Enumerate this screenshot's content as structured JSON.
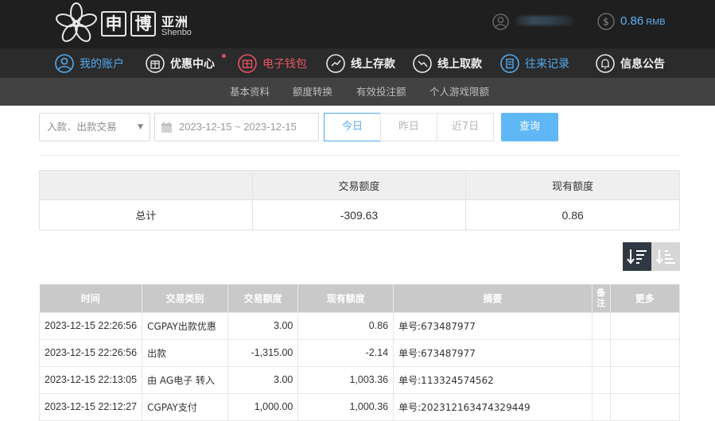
{
  "brand": {
    "name_cn": "申博",
    "region_cn": "亚洲",
    "name_en": "Shenbo"
  },
  "header": {
    "balance_amount": "0.86",
    "balance_currency": "RMB"
  },
  "nav": [
    {
      "label": "我的账户",
      "icon": "user-circle-icon",
      "color": "#52a9ee"
    },
    {
      "label": "优惠中心",
      "icon": "gift-icon"
    },
    {
      "label": "电子钱包",
      "icon": "wallet-icon",
      "color": "#e85563"
    },
    {
      "label": "线上存款",
      "icon": "deposit-icon"
    },
    {
      "label": "线上取款",
      "icon": "withdraw-icon"
    },
    {
      "label": "往来记录",
      "icon": "record-icon",
      "color": "#52a9ee"
    },
    {
      "label": "信息公告",
      "icon": "bell-icon"
    }
  ],
  "subnav": [
    "基本资料",
    "额度转换",
    "有效投注额",
    "个人游戏限额"
  ],
  "filters": {
    "type_select": "入款．出款交易",
    "date_range": "2023-12-15 ~ 2023-12-15",
    "quick": [
      "今日",
      "昨日",
      "近7日"
    ],
    "query_label": "查询"
  },
  "summary": {
    "headers": [
      "",
      "交易额度",
      "现有额度"
    ],
    "row": [
      "总计",
      "-309.63",
      "0.86"
    ]
  },
  "table": {
    "headers": [
      "时间",
      "交易类别",
      "交易额度",
      "现有额度",
      "摘要",
      "备注",
      "更多"
    ],
    "rows": [
      [
        "2023-12-15 22:26:56",
        "CGPAY出款优惠",
        "3.00",
        "0.86",
        "单号:673487977",
        "",
        ""
      ],
      [
        "2023-12-15 22:26:56",
        "出款",
        "-1,315.00",
        "-2.14",
        "单号:673487977",
        "",
        ""
      ],
      [
        "2023-12-15 22:13:05",
        "由 AG电子 转入",
        "3.00",
        "1,003.36",
        "单号:113324574562",
        "",
        ""
      ],
      [
        "2023-12-15 22:12:27",
        "CGPAY支付",
        "1,000.00",
        "1,000.36",
        "单号:202312163474329449",
        "",
        ""
      ]
    ]
  },
  "colors": {
    "accent": "#52a9ee",
    "query_button": "#5fb7f5",
    "nav_active_red": "#e85563"
  }
}
